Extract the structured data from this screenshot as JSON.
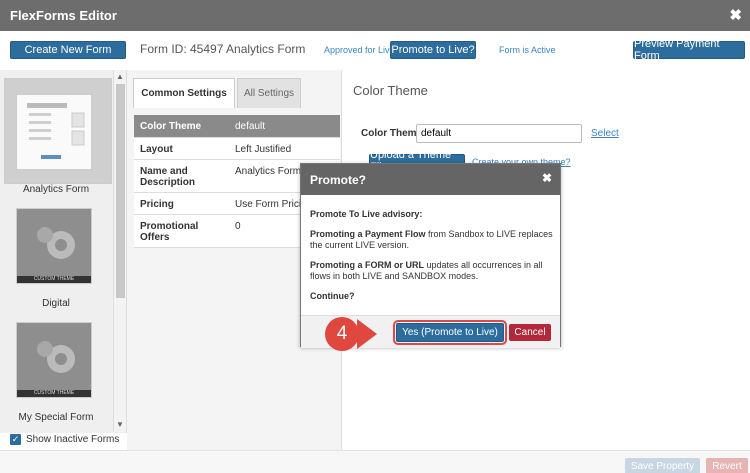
{
  "app": {
    "title": "FlexForms Editor"
  },
  "header": {
    "create_button": "Create New Form",
    "form_id_text": "Form ID:  45497  Analytics Form",
    "approved_text": "Approved for Live",
    "promote_button": "Promote to Live?",
    "active_text": "Form is Active",
    "preview_button": "Preview Payment Form"
  },
  "sidebar": {
    "items": [
      {
        "label": "Analytics Form"
      },
      {
        "label": "Digital"
      },
      {
        "label": "My Special Form"
      }
    ],
    "thumb_band": "CUSTOM THEME",
    "show_inactive": "Show Inactive Forms"
  },
  "tabs": [
    {
      "label": "Common Settings"
    },
    {
      "label": "All Settings"
    }
  ],
  "settings": [
    {
      "k": "Color Theme",
      "v": "default"
    },
    {
      "k": "Layout",
      "v": "Left Justified"
    },
    {
      "k": "Name and Description",
      "v": "Analytics Form"
    },
    {
      "k": "Pricing",
      "v": "Use Form Pricing"
    },
    {
      "k": "Promotional Offers",
      "v": "0"
    }
  ],
  "color_theme": {
    "title": "Color Theme",
    "label": "Color Theme",
    "value": "default",
    "select_link": "Select",
    "upload_button": "Upload a Theme File",
    "create_link": "Create your own theme?"
  },
  "footer": {
    "save": "Save Property",
    "revert": "Revert"
  },
  "modal": {
    "title": "Promote?",
    "advisory": "Promote To Live advisory:",
    "p1_bold": "Promoting a Payment Flow",
    "p1_rest": " from Sandbox to LIVE replaces the current LIVE version.",
    "p2_bold": "Promoting a FORM or URL",
    "p2_rest": " updates all occurrences in all flows in both LIVE and SANDBOX modes.",
    "continue": "Continue?",
    "yes_button": "Yes (Promote to Live)",
    "cancel_button": "Cancel"
  },
  "step_number": "4"
}
